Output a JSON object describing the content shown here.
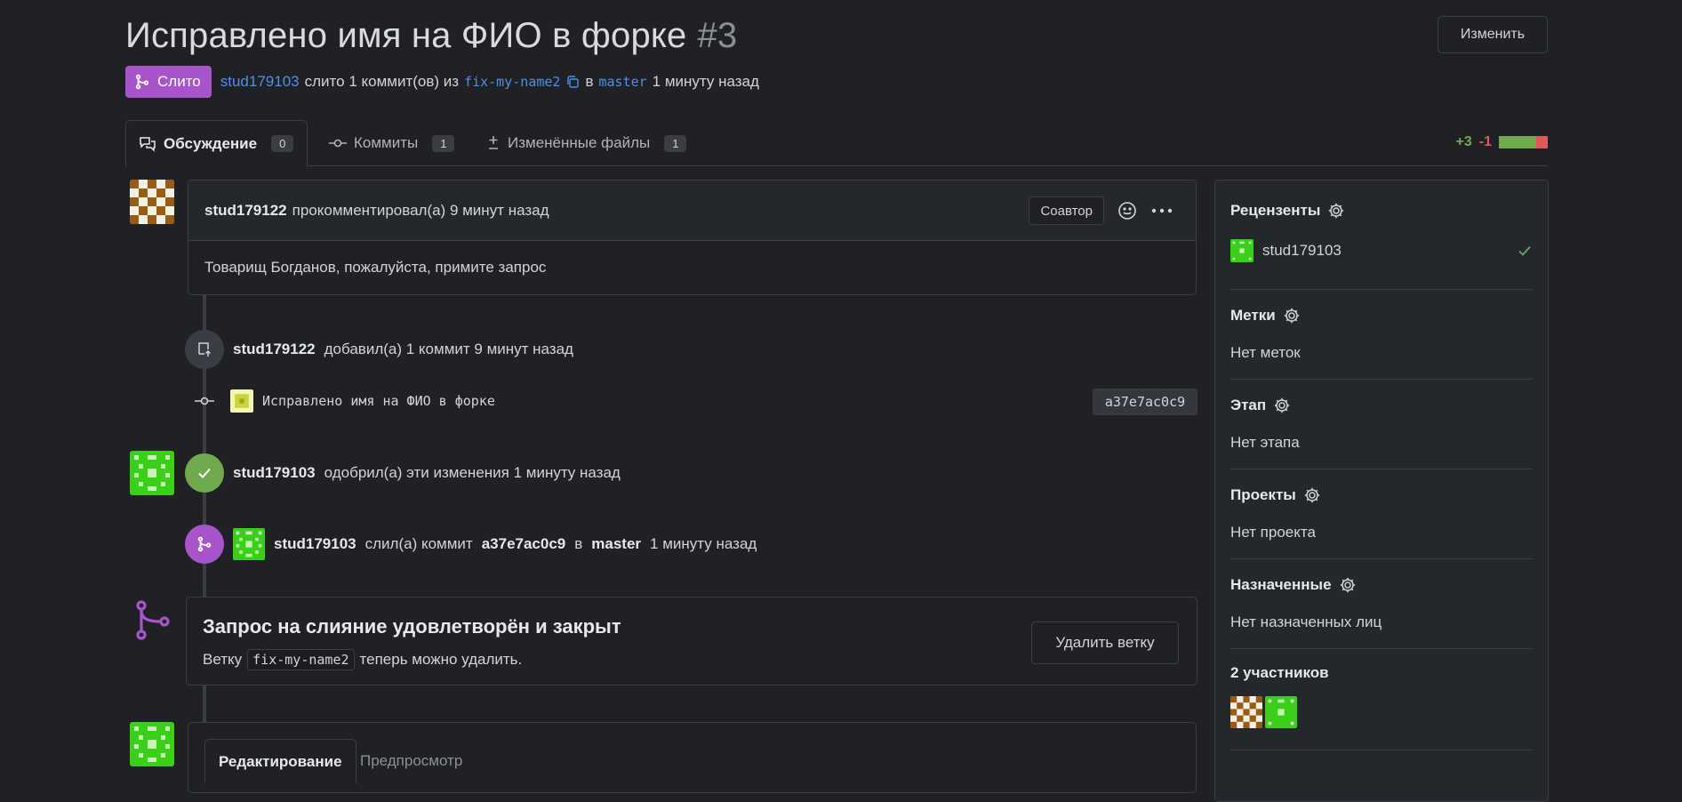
{
  "header": {
    "title": "Исправлено имя на ФИО в форке",
    "number": "#3",
    "edit_label": "Изменить"
  },
  "meta": {
    "badge": "Слито",
    "author": "stud179103",
    "text1": "слито 1 коммит(ов) из",
    "source_branch": "fix-my-name2",
    "text2": "в",
    "target_branch": "master",
    "time": "1 минуту назад"
  },
  "tabs": [
    {
      "label": "Обсуждение",
      "count": "0"
    },
    {
      "label": "Коммиты",
      "count": "1"
    },
    {
      "label": "Изменённые файлы",
      "count": "1"
    }
  ],
  "diffstat": {
    "plus": "+3",
    "minus": "-1"
  },
  "comment": {
    "author": "stud179122",
    "action": "прокомментировал(а) 9 минут назад",
    "coauthor_label": "Соавтор",
    "body": "Товарищ Богданов, пожалуйста, примите запрос"
  },
  "events": {
    "push": {
      "author": "stud179122",
      "text": "добавил(а) 1 коммит 9 минут назад"
    },
    "commit": {
      "message": "Исправлено имя на ФИО в форке",
      "sha": "a37e7ac0c9"
    },
    "approve": {
      "author": "stud179103",
      "text": "одобрил(а) эти изменения 1 минуту назад"
    },
    "merge": {
      "author": "stud179103",
      "text1": "слил(а) коммит",
      "sha": "a37e7ac0c9",
      "text2": "в",
      "branch": "master",
      "time": "1 минуту назад"
    }
  },
  "merge_box": {
    "title": "Запрос на слияние удовлетворён и закрыт",
    "sub1": "Ветку",
    "branch": "fix-my-name2",
    "sub2": "теперь можно удалить.",
    "delete_label": "Удалить ветку"
  },
  "editor": {
    "tab_edit": "Редактирование",
    "tab_preview": "Предпросмотр"
  },
  "sidebar": {
    "reviewers": {
      "title": "Рецензенты",
      "user": "stud179103"
    },
    "labels": {
      "title": "Метки",
      "value": "Нет меток"
    },
    "milestone": {
      "title": "Этап",
      "value": "Нет этапа"
    },
    "projects": {
      "title": "Проекты",
      "value": "Нет проекта"
    },
    "assignees": {
      "title": "Назначенные",
      "value": "Нет назначенных лиц"
    },
    "participants": {
      "title": "2 участников"
    }
  },
  "colors": {
    "merged": "#a855cc",
    "approved": "#6faa4c",
    "link": "#4f8fe6"
  }
}
